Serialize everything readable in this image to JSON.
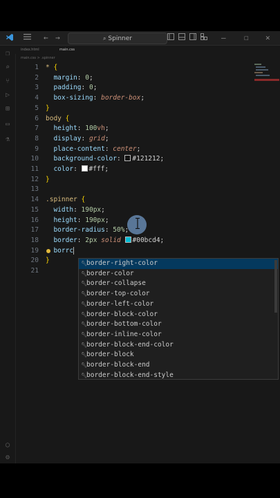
{
  "titlebar": {
    "search_text": "Spinner",
    "icons": [
      "vscode-logo-icon",
      "menu-icon",
      "arrow-left-icon",
      "arrow-right-icon",
      "layout-icon",
      "panel-icon",
      "split-icon",
      "customize-icon",
      "minimize-icon",
      "maximize-icon",
      "close-icon"
    ]
  },
  "tabs": [
    "index.html",
    "main.css"
  ],
  "breadcrumb": "main.css > .spinner",
  "activity_icons": [
    "explorer-icon",
    "search-icon",
    "source-control-icon",
    "run-debug-icon",
    "extensions-icon",
    "remote-icon",
    "testing-icon",
    "account-icon",
    "settings-icon"
  ],
  "lines": {
    "n": [
      "1",
      "2",
      "3",
      "4",
      "5",
      "6",
      "7",
      "8",
      "9",
      "10",
      "11",
      "12",
      "13",
      "14",
      "15",
      "16",
      "17",
      "18",
      "19",
      "20",
      "21"
    ],
    "l1": {
      "sel": "* ",
      "brace": "{"
    },
    "l2": {
      "prop": "margin",
      "val": "0"
    },
    "l3": {
      "prop": "padding",
      "val": "0"
    },
    "l4": {
      "prop": "box-sizing",
      "val": "border-box"
    },
    "l5": {
      "brace": "}"
    },
    "l6": {
      "sel": "body ",
      "brace": "{"
    },
    "l7": {
      "prop": "height",
      "num": "100",
      "unit": "vh"
    },
    "l8": {
      "prop": "display",
      "val": "grid"
    },
    "l9": {
      "prop": "place-content",
      "val": "center"
    },
    "l10": {
      "prop": "background-color",
      "val": "#121212",
      "swatch": "#121212"
    },
    "l11": {
      "prop": "color",
      "val": "#fff",
      "swatch": "#ffffff"
    },
    "l12": {
      "brace": "}"
    },
    "l14": {
      "sel": ".spinner ",
      "brace": "{"
    },
    "l15": {
      "prop": "width",
      "num": "190",
      "unit": "px"
    },
    "l16": {
      "prop": "height",
      "num": "190",
      "unit": "px"
    },
    "l17": {
      "prop": "border-radius",
      "num": "50",
      "unit": "%"
    },
    "l18": {
      "prop": "border",
      "num": "2",
      "unit": "px",
      "kw": "solid",
      "val": "#00bcd4",
      "swatch": "#00bcd4"
    },
    "l19": {
      "typed": "borrc"
    },
    "l20": {
      "brace": "}"
    }
  },
  "suggestions": [
    "border-right-color",
    "border-color",
    "border-collapse",
    "border-top-color",
    "border-left-color",
    "border-block-color",
    "border-bottom-color",
    "border-inline-color",
    "border-block-end-color",
    "border-block",
    "border-block-end",
    "border-block-end-style"
  ],
  "colors": {
    "editor_bg": "#181818",
    "selector": "#d7ba7d",
    "property": "#9cdcfe",
    "number": "#b5cea8",
    "value": "#ce9178",
    "brace": "#ffd700",
    "suggest_selected": "#04395e"
  }
}
